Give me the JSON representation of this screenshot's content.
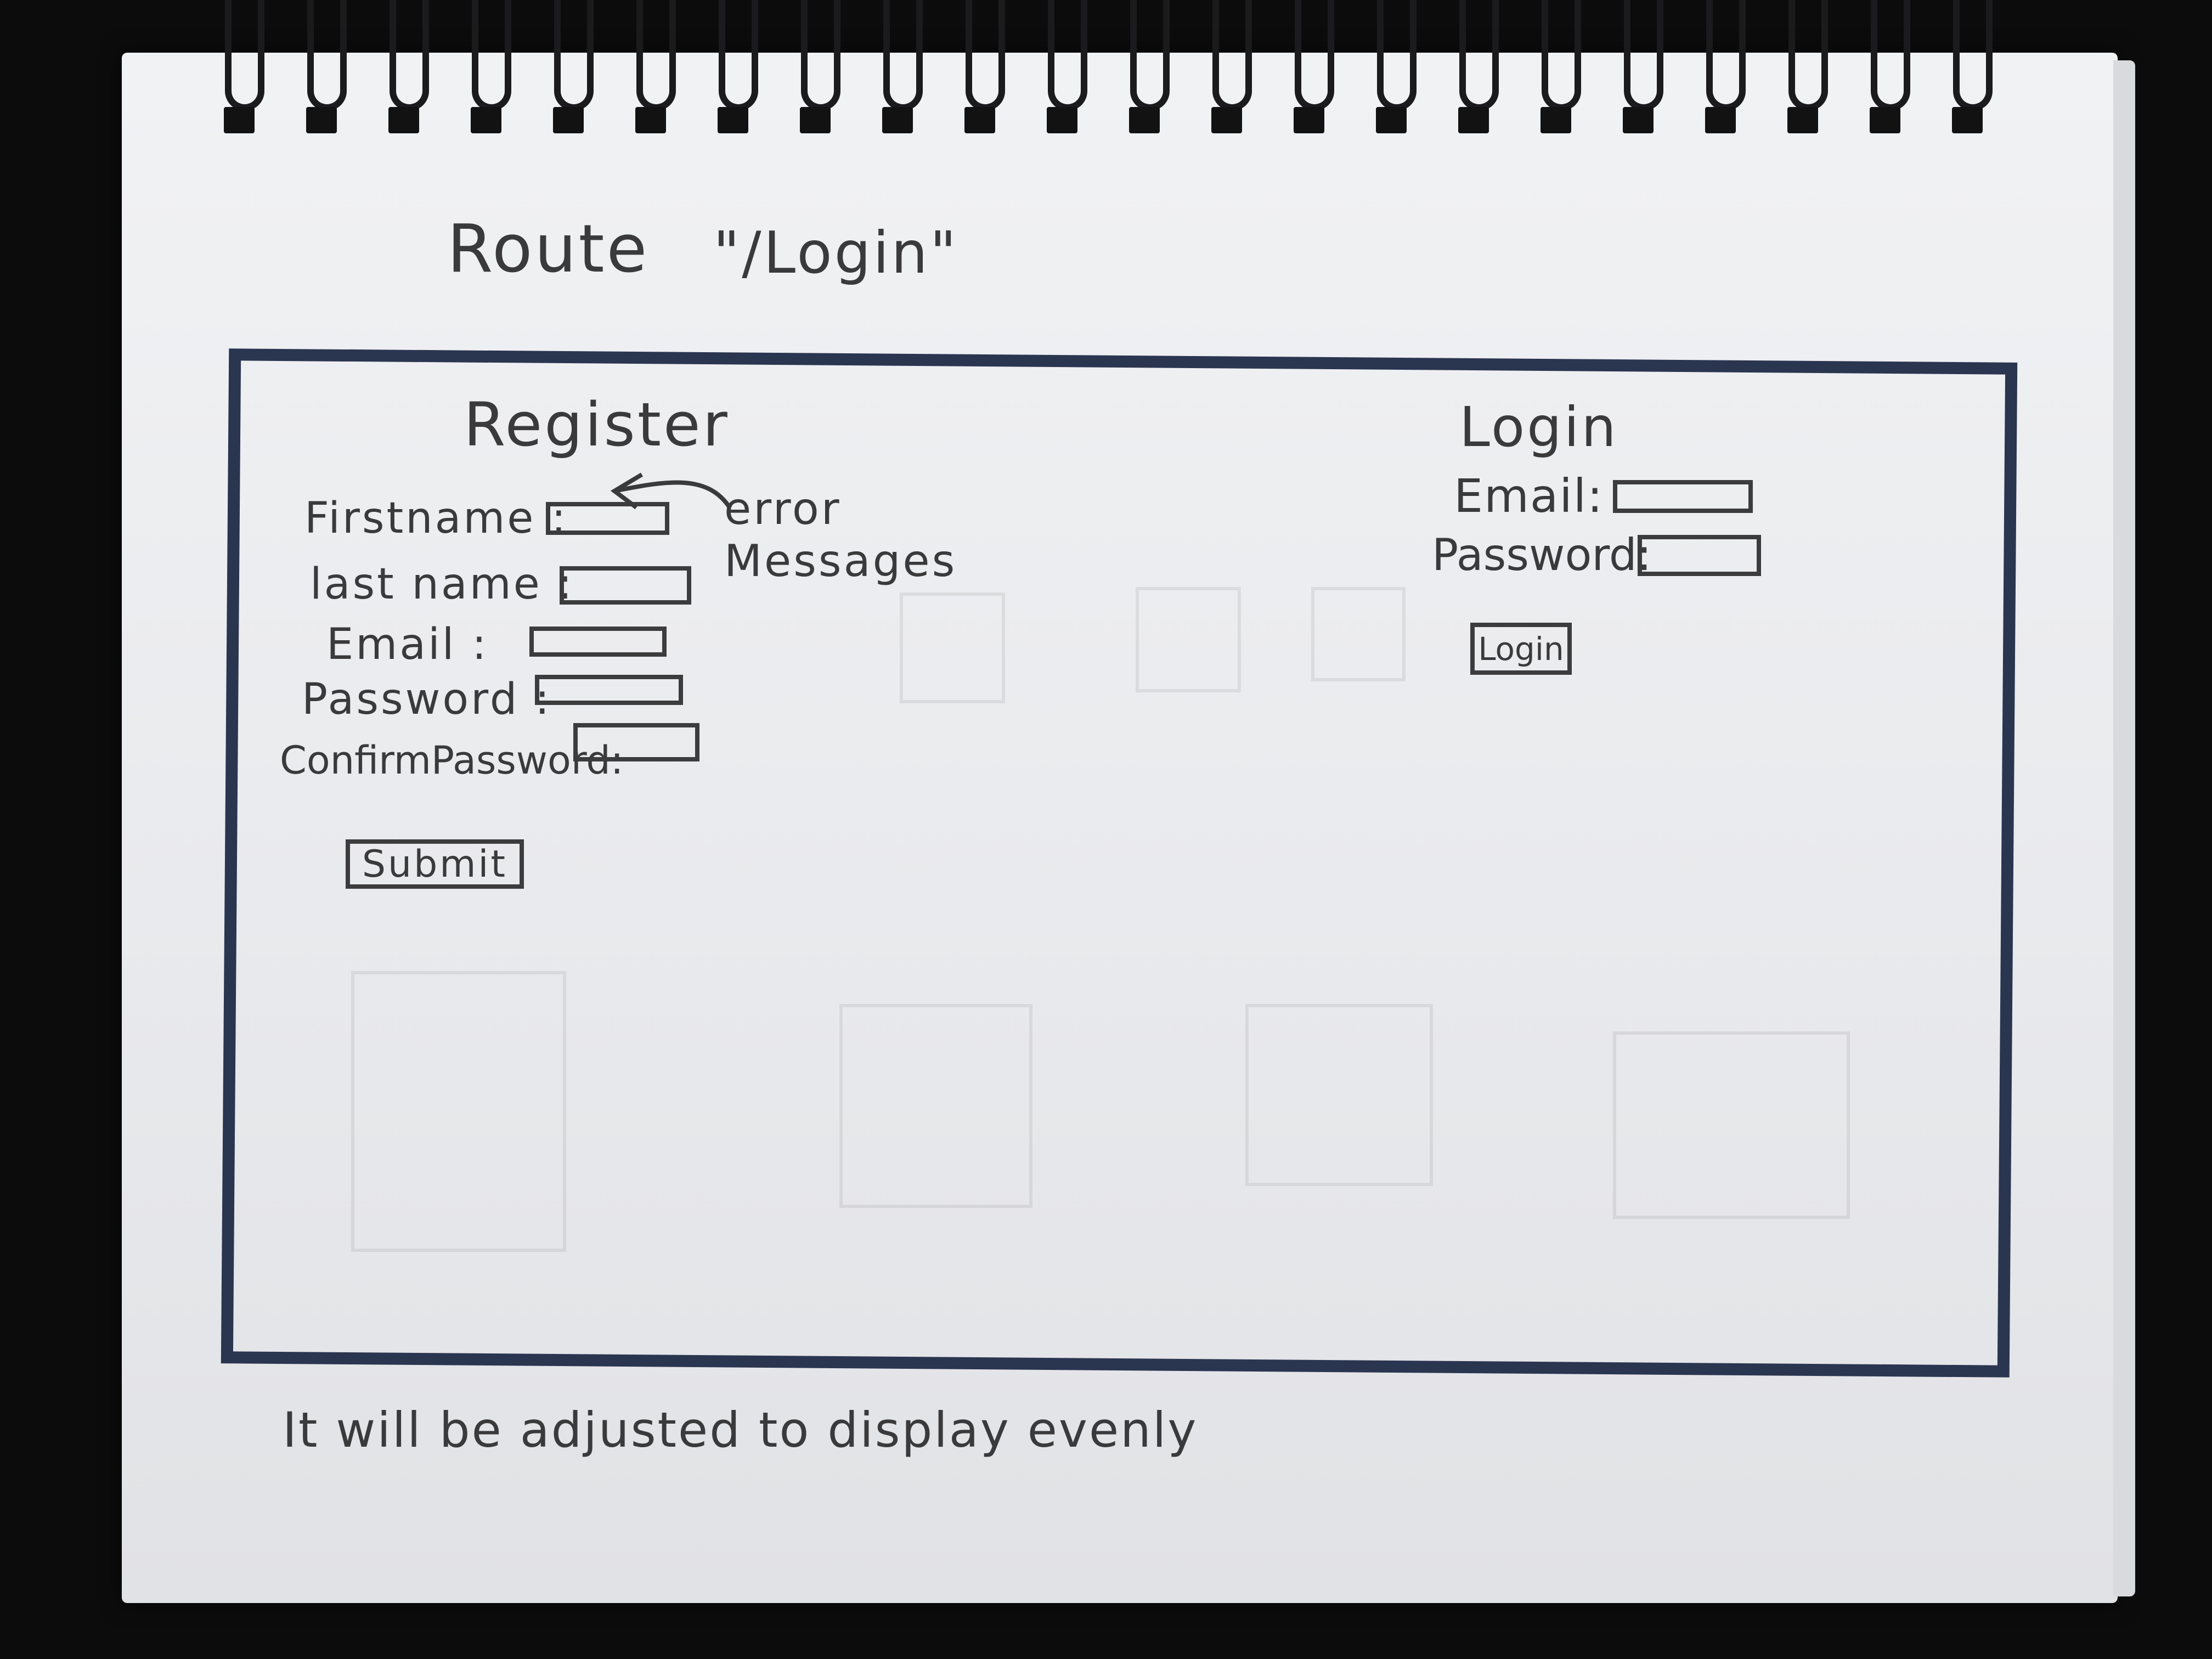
{
  "route": {
    "label": "Route",
    "path": "\"/Login\""
  },
  "register": {
    "title": "Register",
    "fields": [
      {
        "label": "Firstname :"
      },
      {
        "label": "last name :"
      },
      {
        "label": "Email :"
      },
      {
        "label": "Password :"
      },
      {
        "label": "ConfirmPassword:"
      }
    ],
    "submit_label": "Submit",
    "note": "error Messages"
  },
  "login": {
    "title": "Login",
    "fields": [
      {
        "label": "Email:"
      },
      {
        "label": "Password:"
      }
    ],
    "button_label": "Login"
  },
  "footer_note": "It will be adjusted to display evenly",
  "colors": {
    "frame": "#2a3550",
    "pencil": "#3a3a3c",
    "paper": "#eceef1"
  }
}
